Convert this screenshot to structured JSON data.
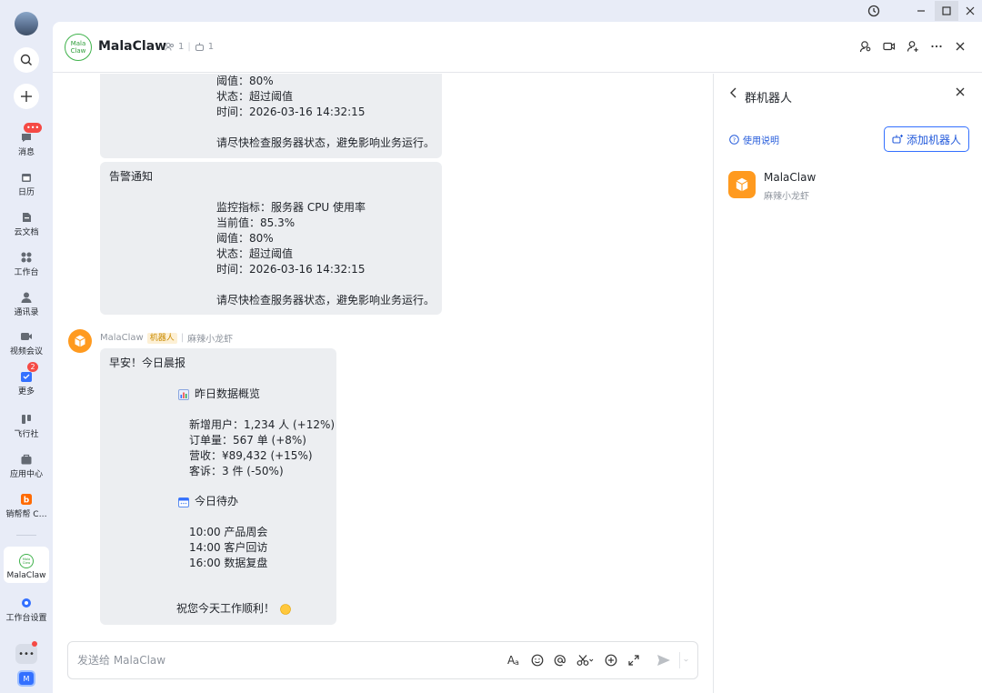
{
  "sidebar": {
    "items": [
      {
        "label": "消息",
        "icon": "message-icon",
        "badge": "•••"
      },
      {
        "label": "日历",
        "icon": "calendar-icon"
      },
      {
        "label": "云文档",
        "icon": "cloud-doc-icon"
      },
      {
        "label": "工作台",
        "icon": "workbench-icon"
      },
      {
        "label": "通讯录",
        "icon": "contacts-icon"
      },
      {
        "label": "视频会议",
        "icon": "video-meeting-icon"
      },
      {
        "label": "更多",
        "icon": "more-icon",
        "badge": "2"
      },
      {
        "label": "飞行社",
        "icon": "flight-club-icon"
      },
      {
        "label": "应用中心",
        "icon": "app-center-icon"
      },
      {
        "label": "销帮帮 C…",
        "icon": "xbb-icon"
      },
      {
        "label": "MalaClaw",
        "icon": "malaclaw-app-icon",
        "logo_text": "Mala Claw"
      },
      {
        "label": "工作台设置",
        "icon": "workbench-settings-icon"
      }
    ],
    "bottom_app_letter": "M"
  },
  "header": {
    "logo_text": "Mala Claw",
    "title": "MalaClaw",
    "member_count": "1",
    "bot_count": "1"
  },
  "messages": {
    "alert_partial": {
      "lines": [
        "阈值：80%",
        "状态：超过阈值",
        "时间：2026-03-16 14:32:15",
        "请尽快检查服务器状态，避免影响业务运行。"
      ]
    },
    "alert_full": {
      "title": "告警通知",
      "lines": [
        "监控指标：服务器 CPU 使用率",
        "当前值：85.3%",
        "阈值：80%",
        "状态：超过阈值",
        "时间：2026-03-16 14:32:15",
        "请尽快检查服务器状态，避免影响业务运行。"
      ]
    },
    "report": {
      "sender": "MalaClaw",
      "robot_tag": "机器人",
      "bot_desc": "麻辣小龙虾",
      "greeting": "早安！今日晨报",
      "section1_title": "昨日数据概览",
      "section1_lines": [
        "新增用户：1,234 人 (+12%)",
        "订单量：567 单 (+8%)",
        "营收：¥89,432 (+15%)",
        "客诉：3 件 (-50%)"
      ],
      "section2_title": "今日待办",
      "section2_lines": [
        "10:00 产品周会",
        "14:00 客户回访",
        "16:00 数据复盘"
      ],
      "closing": "祝您今天工作顺利！"
    }
  },
  "input": {
    "placeholder": "发送给 MalaClaw"
  },
  "panel": {
    "title": "群机器人",
    "help_label": "使用说明",
    "add_button_label": "添加机器人",
    "robots": [
      {
        "name": "MalaClaw",
        "desc": "麻辣小龙虾"
      }
    ]
  },
  "colors": {
    "accent": "#3370ff",
    "robot_orange": "#ff9a1f",
    "badge_red": "#f54a45",
    "bubble_bg": "#eceef1"
  }
}
